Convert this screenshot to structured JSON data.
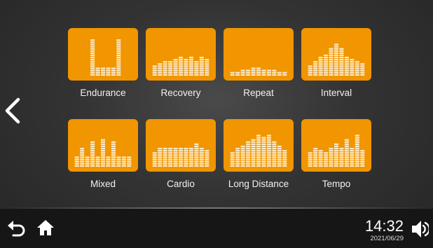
{
  "workouts": [
    {
      "label": "Endurance",
      "profile": [
        0,
        0,
        0,
        1,
        0.25,
        0.25,
        0.25,
        0.25,
        1,
        0,
        0
      ]
    },
    {
      "label": "Recovery",
      "profile": [
        0.3,
        0.35,
        0.4,
        0.4,
        0.45,
        0.55,
        0.45,
        0.55,
        0.4,
        0.55,
        0.45
      ]
    },
    {
      "label": "Repeat",
      "profile": [
        0.1,
        0.1,
        0.15,
        0.2,
        0.25,
        0.25,
        0.2,
        0.2,
        0.15,
        0.1,
        0.1
      ]
    },
    {
      "label": "Interval",
      "profile": [
        0.3,
        0.4,
        0.5,
        0.6,
        0.75,
        0.9,
        0.75,
        0.55,
        0.45,
        0.4,
        0.35
      ]
    },
    {
      "label": "Mixed",
      "profile": [
        0.3,
        0.55,
        0.3,
        0.7,
        0.3,
        0.75,
        0.3,
        0.7,
        0.3,
        0.3,
        0.3
      ]
    },
    {
      "label": "Cardio",
      "profile": [
        0.4,
        0.5,
        0.55,
        0.5,
        0.55,
        0.5,
        0.55,
        0.5,
        0.65,
        0.5,
        0.45
      ]
    },
    {
      "label": "Long Distance",
      "profile": [
        0.4,
        0.55,
        0.6,
        0.7,
        0.75,
        0.9,
        0.85,
        0.9,
        0.7,
        0.6,
        0.45
      ]
    },
    {
      "label": "Tempo",
      "profile": [
        0.4,
        0.55,
        0.45,
        0.4,
        0.5,
        0.65,
        0.55,
        0.75,
        0.5,
        0.9,
        0.45
      ]
    }
  ],
  "status": {
    "time": "14:32",
    "date": "2021/06/29"
  },
  "colors": {
    "accent": "#f19500",
    "bar": "#fdebc9",
    "background": "#333333",
    "bottom_bar": "#161616"
  },
  "icons": {
    "back": "chevron-left-icon",
    "return": "return-arrow-icon",
    "home": "home-icon",
    "volume": "speaker-icon"
  }
}
